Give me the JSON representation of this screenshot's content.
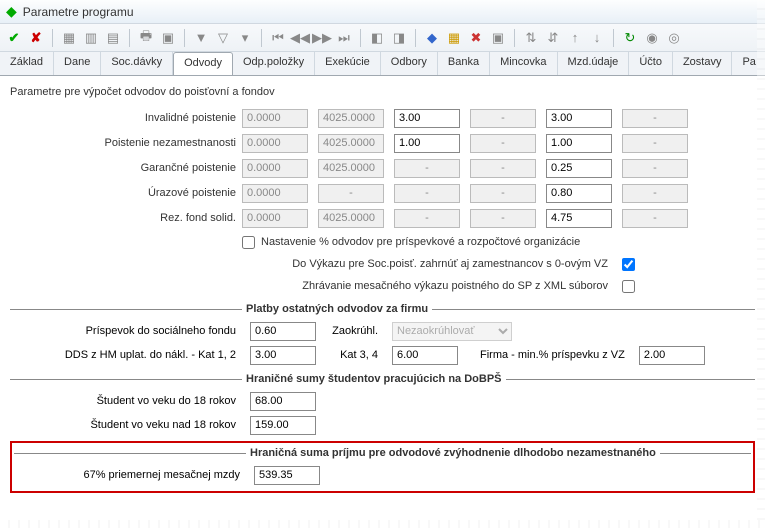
{
  "window": {
    "title": "Parametre programu"
  },
  "tabs": [
    "Základ",
    "Dane",
    "Soc.dávky",
    "Odvody",
    "Odp.položky",
    "Exekúcie",
    "Odbory",
    "Banka",
    "Mincovka",
    "Mzd.údaje",
    "Účto",
    "Zostavy",
    "Pa"
  ],
  "active_tab": 3,
  "section_title": "Parametre pre výpočet odvodov do poisťovní a fondov",
  "rows": [
    {
      "label": "Invalidné poistenie",
      "c": [
        {
          "v": "0.0000",
          "ro": true
        },
        {
          "v": "4025.0000",
          "ro": true
        },
        {
          "v": "3.00"
        },
        {
          "dash": true
        },
        {
          "v": "3.00"
        },
        {
          "dash": true
        }
      ]
    },
    {
      "label": "Poistenie  nezamestnanosti",
      "c": [
        {
          "v": "0.0000",
          "ro": true
        },
        {
          "v": "4025.0000",
          "ro": true
        },
        {
          "v": "1.00"
        },
        {
          "dash": true
        },
        {
          "v": "1.00"
        },
        {
          "dash": true
        }
      ]
    },
    {
      "label": "Garančné poistenie",
      "c": [
        {
          "v": "0.0000",
          "ro": true
        },
        {
          "v": "4025.0000",
          "ro": true
        },
        {
          "dash": true
        },
        {
          "dash": true
        },
        {
          "v": "0.25"
        },
        {
          "dash": true
        }
      ]
    },
    {
      "label": "Úrazové poistenie",
      "c": [
        {
          "v": "0.0000",
          "ro": true
        },
        {
          "dash": true
        },
        {
          "dash": true
        },
        {
          "dash": true
        },
        {
          "v": "0.80"
        },
        {
          "dash": true
        }
      ]
    },
    {
      "label": "Rez. fond solid.",
      "c": [
        {
          "v": "0.0000",
          "ro": true
        },
        {
          "v": "4025.0000",
          "ro": true
        },
        {
          "dash": true
        },
        {
          "dash": true
        },
        {
          "v": "4.75"
        },
        {
          "dash": true
        }
      ]
    }
  ],
  "checks": {
    "org": "Nastavenie % odvodov pre príspevkové a rozpočtové organizácie",
    "vz0": "Do Výkazu pre Soc.poisť. zahrnúť aj zamestnancov s 0-ovým VZ",
    "xml": "Zhrávanie mesačného výkazu poistného do SP z XML súborov"
  },
  "sub1": {
    "title": "Platby ostatných odvodov za firmu",
    "prispevok_lbl": "Príspevok do sociálneho fondu",
    "prispevok_val": "0.60",
    "zaokr_lbl": "Zaokrúhl.",
    "zaokr_val": "Nezaokrúhlovať",
    "dds_lbl": "DDS z HM uplat. do nákl. - Kat 1, 2",
    "dds_val": "3.00",
    "kat34_lbl": "Kat 3, 4",
    "kat34_val": "6.00",
    "firma_lbl": "Firma - min.% príspevku z VZ",
    "firma_val": "2.00"
  },
  "sub2": {
    "title": "Hraničné sumy študentov pracujúcich na DoBPŠ",
    "s18_lbl": "Študent vo veku do 18 rokov",
    "s18_val": "68.00",
    "s18p_lbl": "Študent vo veku nad 18 rokov",
    "s18p_val": "159.00"
  },
  "sub3": {
    "title": "Hraničná suma príjmu pre odvodové zvýhodnenie dlhodobo nezamestnaného",
    "pct_lbl": "67% priemernej mesačnej mzdy",
    "pct_val": "539.35"
  }
}
